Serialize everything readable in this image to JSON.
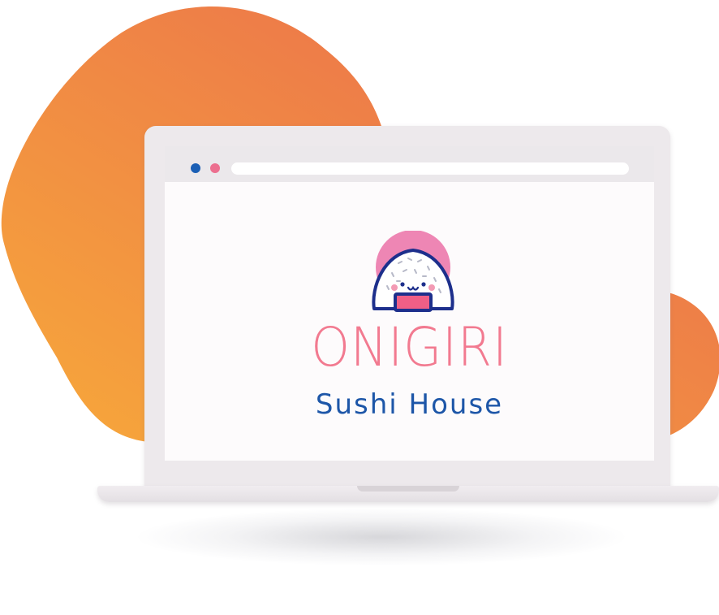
{
  "brand": {
    "title": "ONIGIRI",
    "subtitle": "Sushi House"
  },
  "browser": {
    "window_dots": [
      {
        "name": "blue-dot",
        "color": "#1b5fb5"
      },
      {
        "name": "pink-dot",
        "color": "#ec6f8f"
      }
    ]
  },
  "colors": {
    "blob_gradient_start": "#f7a93a",
    "blob_gradient_end": "#e9684f",
    "title_color": "#f27a90",
    "subtitle_color": "#1d56a8",
    "mascot_pink": "#ee86b4",
    "mascot_outline": "#1d2f8c"
  },
  "icons": {
    "mascot": "onigiri-mascot-icon"
  }
}
